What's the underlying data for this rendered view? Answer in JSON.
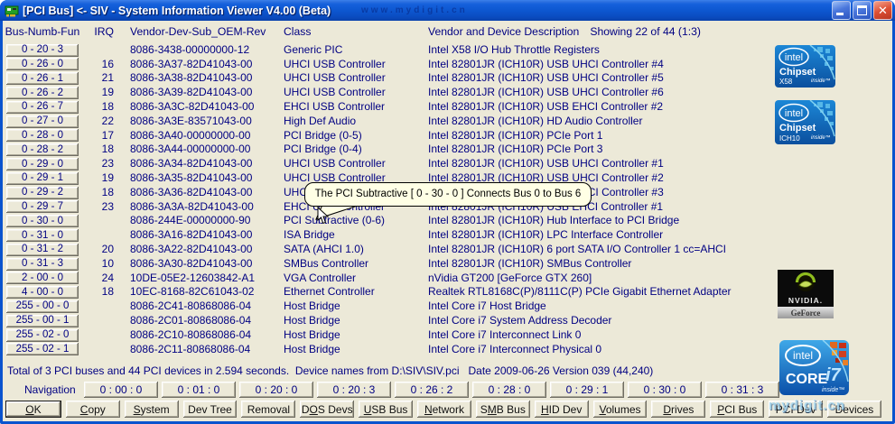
{
  "window": {
    "title": "[PCI Bus] <- SIV - System Information Viewer V4.00 (Beta)",
    "title_watermark": "www.mydigit.cn",
    "corner_watermark": "mydigit.cn"
  },
  "colors": {
    "text_navy": "#000082",
    "client_bg": "#ECE9D8",
    "titlebar_blue": "#0D57D0",
    "tooltip_bg": "#FFFFE5",
    "close_red": "#DD4F33"
  },
  "columns": {
    "bus": "Bus-Numb-Fun",
    "irq": "IRQ",
    "vendor": "Vendor-Dev-Sub_OEM-Rev",
    "cls": "Class",
    "desc": "Vendor and Device Description",
    "showing": "Showing 22 of 44 (1:3)"
  },
  "rows": [
    {
      "bus": "0 - 20 - 3",
      "irq": "",
      "vendor": "8086-3438-00000000-12",
      "cls": "Generic PIC",
      "desc": "Intel X58 I/O Hub Throttle Registers"
    },
    {
      "bus": "0 - 26 - 0",
      "irq": "16",
      "vendor": "8086-3A37-82D41043-00",
      "cls": "UHCI USB Controller",
      "desc": "Intel 82801JR (ICH10R) USB UHCI Controller #4"
    },
    {
      "bus": "0 - 26 - 1",
      "irq": "21",
      "vendor": "8086-3A38-82D41043-00",
      "cls": "UHCI USB Controller",
      "desc": "Intel 82801JR (ICH10R) USB UHCI Controller #5"
    },
    {
      "bus": "0 - 26 - 2",
      "irq": "19",
      "vendor": "8086-3A39-82D41043-00",
      "cls": "UHCI USB Controller",
      "desc": "Intel 82801JR (ICH10R) USB UHCI Controller #6"
    },
    {
      "bus": "0 - 26 - 7",
      "irq": "18",
      "vendor": "8086-3A3C-82D41043-00",
      "cls": "EHCI USB Controller",
      "desc": "Intel 82801JR (ICH10R) USB EHCI Controller #2"
    },
    {
      "bus": "0 - 27 - 0",
      "irq": "22",
      "vendor": "8086-3A3E-83571043-00",
      "cls": "High Def Audio",
      "desc": "Intel 82801JR (ICH10R) HD Audio Controller"
    },
    {
      "bus": "0 - 28 - 0",
      "irq": "17",
      "vendor": "8086-3A40-00000000-00",
      "cls": "PCI Bridge (0-5)",
      "desc": "Intel 82801JR (ICH10R) PCIe Port 1"
    },
    {
      "bus": "0 - 28 - 2",
      "irq": "18",
      "vendor": "8086-3A44-00000000-00",
      "cls": "PCI Bridge (0-4)",
      "desc": "Intel 82801JR (ICH10R) PCIe Port 3"
    },
    {
      "bus": "0 - 29 - 0",
      "irq": "23",
      "vendor": "8086-3A34-82D41043-00",
      "cls": "UHCI USB Controller",
      "desc": "Intel 82801JR (ICH10R) USB UHCI Controller #1"
    },
    {
      "bus": "0 - 29 - 1",
      "irq": "19",
      "vendor": "8086-3A35-82D41043-00",
      "cls": "UHCI USB Controller",
      "desc": "Intel 82801JR (ICH10R) USB UHCI Controller #2"
    },
    {
      "bus": "0 - 29 - 2",
      "irq": "18",
      "vendor": "8086-3A36-82D41043-00",
      "cls": "UHCI USB Controller",
      "desc": "Intel 82801JR (ICH10R) USB UHCI Controller #3"
    },
    {
      "bus": "0 - 29 - 7",
      "irq": "23",
      "vendor": "8086-3A3A-82D41043-00",
      "cls": "EHCI USB Controller",
      "desc": "Intel 82801JR (ICH10R) USB EHCI Controller #1"
    },
    {
      "bus": "0 - 30 - 0",
      "irq": "",
      "vendor": "8086-244E-00000000-90",
      "cls": "PCI Subtractive (0-6)",
      "desc": "Intel 82801JR (ICH10R) Hub Interface to PCI Bridge"
    },
    {
      "bus": "0 - 31 - 0",
      "irq": "",
      "vendor": "8086-3A16-82D41043-00",
      "cls": "ISA Bridge",
      "desc": "Intel 82801JR (ICH10R) LPC Interface Controller"
    },
    {
      "bus": "0 - 31 - 2",
      "irq": "20",
      "vendor": "8086-3A22-82D41043-00",
      "cls": "SATA (AHCI 1.0)",
      "desc": "Intel 82801JR (ICH10R) 6 port SATA I/O Controller 1 cc=AHCI"
    },
    {
      "bus": "0 - 31 - 3",
      "irq": "10",
      "vendor": "8086-3A30-82D41043-00",
      "cls": "SMBus Controller",
      "desc": "Intel 82801JR (ICH10R) SMBus Controller"
    },
    {
      "bus": "2 - 00 - 0",
      "irq": "24",
      "vendor": "10DE-05E2-12603842-A1",
      "cls": "VGA Controller",
      "desc": "nVidia GT200 [GeForce GTX 260]"
    },
    {
      "bus": "4 - 00 - 0",
      "irq": "18",
      "vendor": "10EC-8168-82C61043-02",
      "cls": "Ethernet Controller",
      "desc": "Realtek RTL8168C(P)/8111C(P) PCIe Gigabit Ethernet Adapter"
    },
    {
      "bus": "255 - 00 - 0",
      "irq": "",
      "vendor": "8086-2C41-80868086-04",
      "cls": "Host Bridge",
      "desc": "Intel Core i7 Host Bridge"
    },
    {
      "bus": "255 - 00 - 1",
      "irq": "",
      "vendor": "8086-2C01-80868086-04",
      "cls": "Host Bridge",
      "desc": "Intel Core i7 System Address Decoder"
    },
    {
      "bus": "255 - 02 - 0",
      "irq": "",
      "vendor": "8086-2C10-80868086-04",
      "cls": "Host Bridge",
      "desc": "Intel Core i7 Interconnect Link 0"
    },
    {
      "bus": "255 - 02 - 1",
      "irq": "",
      "vendor": "8086-2C11-80868086-04",
      "cls": "Host Bridge",
      "desc": "Intel Core i7 Interconnect Physical 0"
    }
  ],
  "tooltip": {
    "text": "The PCI Subtractive [ 0 - 30 - 0 ] Connects Bus 0 to Bus 6"
  },
  "status": "Total of 3 PCI buses and 44 PCI devices in 2.594 seconds.  Device names from D:\\SIV\\SIV.pci   Date 2009-06-26 Version 039 (44,240)",
  "navigation": {
    "label": "Navigation",
    "buttons": [
      "0 : 00 : 0",
      "0 : 01 : 0",
      "0 : 20 : 0",
      "0 : 20 : 3",
      "0 : 26 : 2",
      "0 : 28 : 0",
      "0 : 29 : 1",
      "0 : 30 : 0",
      "0 : 31 : 3"
    ]
  },
  "footer_buttons": [
    {
      "pre": "",
      "key": "O",
      "post": "K"
    },
    {
      "pre": "",
      "key": "C",
      "post": "opy"
    },
    {
      "pre": "",
      "key": "S",
      "post": "ystem"
    },
    {
      "pre": "Dev Tree",
      "key": "",
      "post": ""
    },
    {
      "pre": "Removal",
      "key": "",
      "post": ""
    },
    {
      "pre": "D",
      "key": "O",
      "post": "S Devs"
    },
    {
      "pre": "",
      "key": "U",
      "post": "SB Bus"
    },
    {
      "pre": "",
      "key": "N",
      "post": "etwork"
    },
    {
      "pre": "S",
      "key": "M",
      "post": "B Bus"
    },
    {
      "pre": "",
      "key": "H",
      "post": "ID Dev"
    },
    {
      "pre": "",
      "key": "V",
      "post": "olumes"
    },
    {
      "pre": "",
      "key": "D",
      "post": "rives"
    },
    {
      "pre": "",
      "key": "P",
      "post": "CI Bus"
    },
    {
      "pre": "PCI Dev",
      "key": "",
      "post": ""
    },
    {
      "pre": "Devices",
      "key": "",
      "post": ""
    }
  ],
  "badges": {
    "x58": {
      "brand": "intel",
      "line": "Chipset",
      "model": "X58",
      "tag": "inside™"
    },
    "ich10": {
      "brand": "intel",
      "line": "Chipset",
      "model": "ICH10",
      "tag": "inside™"
    },
    "nvidia": {
      "name": "NVIDIA.",
      "sub": "GeForce"
    },
    "corei7": {
      "brand": "intel",
      "line": "CORE",
      "model": "i7",
      "tag": "inside™"
    }
  }
}
